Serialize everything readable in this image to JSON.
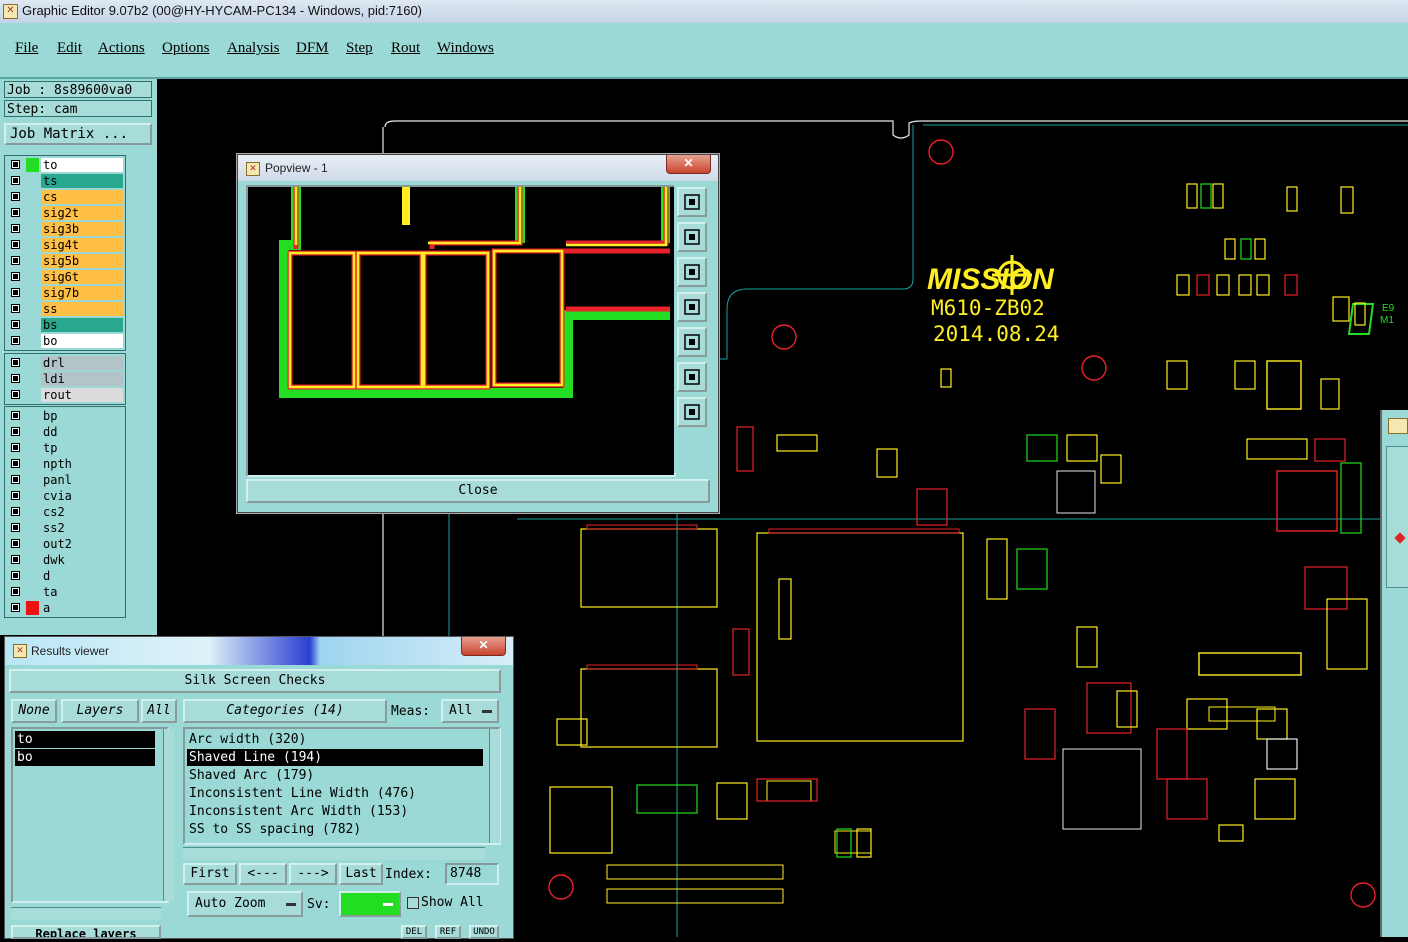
{
  "window": {
    "title": "Graphic Editor 9.07b2 (00@HY-HYCAM-PC134 - Windows, pid:7160)"
  },
  "menu": {
    "items": [
      "File",
      "Edit",
      "Actions",
      "Options",
      "Analysis",
      "DFM",
      "Step",
      "Rout",
      "Windows"
    ]
  },
  "job": {
    "job_label": "Job : 8s89600va0",
    "step_label": "Step: cam",
    "matrix_button": "Job Matrix ..."
  },
  "layers": {
    "group1": [
      {
        "name": "to",
        "color": "#ffffff",
        "swatch": "#22dd22"
      },
      {
        "name": "ts",
        "color": "#2aa88f",
        "swatch": "#9bd9d6"
      },
      {
        "name": "cs",
        "color": "#ffbf45",
        "swatch": "#9bd9d6"
      },
      {
        "name": "sig2t",
        "color": "#ffbf45",
        "swatch": "#9bd9d6"
      },
      {
        "name": "sig3b",
        "color": "#ffbf45",
        "swatch": "#9bd9d6"
      },
      {
        "name": "sig4t",
        "color": "#ffbf45",
        "swatch": "#9bd9d6"
      },
      {
        "name": "sig5b",
        "color": "#ffbf45",
        "swatch": "#9bd9d6"
      },
      {
        "name": "sig6t",
        "color": "#ffbf45",
        "swatch": "#9bd9d6"
      },
      {
        "name": "sig7b",
        "color": "#ffbf45",
        "swatch": "#9bd9d6"
      },
      {
        "name": "ss",
        "color": "#ffbf45",
        "swatch": "#9bd9d6"
      },
      {
        "name": "bs",
        "color": "#2aa88f",
        "swatch": "#9bd9d6"
      },
      {
        "name": "bo",
        "color": "#ffffff",
        "swatch": "#9bd9d6"
      }
    ],
    "group2": [
      {
        "name": "drl",
        "color": "#b3c4c9",
        "swatch": "#9bd9d6"
      },
      {
        "name": "ldi",
        "color": "#b3c4c9",
        "swatch": "#9bd9d6"
      },
      {
        "name": "rout",
        "color": "#dcdcdc",
        "swatch": "#9bd9d6"
      }
    ],
    "group3": [
      {
        "name": "bp",
        "color": "#9bd9d6",
        "swatch": "#9bd9d6"
      },
      {
        "name": "dd",
        "color": "#9bd9d6",
        "swatch": "#9bd9d6"
      },
      {
        "name": "tp",
        "color": "#9bd9d6",
        "swatch": "#9bd9d6"
      },
      {
        "name": "npth",
        "color": "#9bd9d6",
        "swatch": "#9bd9d6"
      },
      {
        "name": "panl",
        "color": "#9bd9d6",
        "swatch": "#9bd9d6"
      },
      {
        "name": "cvia",
        "color": "#9bd9d6",
        "swatch": "#9bd9d6"
      },
      {
        "name": "cs2",
        "color": "#9bd9d6",
        "swatch": "#9bd9d6"
      },
      {
        "name": "ss2",
        "color": "#9bd9d6",
        "swatch": "#9bd9d6"
      },
      {
        "name": "out2",
        "color": "#9bd9d6",
        "swatch": "#9bd9d6"
      },
      {
        "name": "dwk",
        "color": "#9bd9d6",
        "swatch": "#9bd9d6"
      },
      {
        "name": "d",
        "color": "#9bd9d6",
        "swatch": "#9bd9d6"
      },
      {
        "name": "ta",
        "color": "#9bd9d6",
        "swatch": "#9bd9d6"
      },
      {
        "name": "a",
        "color": "#9bd9d6",
        "swatch": "#ee1111"
      }
    ]
  },
  "board": {
    "logo": "MISSION",
    "model": "M610-ZB02",
    "date": "2014.08.24"
  },
  "popview": {
    "title": "Popview - 1",
    "close_label": "Close",
    "close_x": "✕"
  },
  "results": {
    "title": "Results viewer",
    "header": "Silk Screen Checks",
    "none_label": "None",
    "layers_label": "Layers",
    "all_label": "All",
    "layer_list": [
      "to",
      "bo"
    ],
    "categories_label": "Categories (14)",
    "meas_label": "Meas:",
    "meas_value": "All",
    "categories": [
      "Arc width (320)",
      "Shaved Line (194)",
      "Shaved Arc (179)",
      "Inconsistent Line Width (476)",
      "Inconsistent Arc Width (153)",
      "SS to SS spacing (782)"
    ],
    "selected_category": 1,
    "first_label": "First",
    "prev_label": "<---",
    "next_label": "--->",
    "last_label": "Last",
    "index_label": "Index:",
    "index_value": "8748",
    "autozoom_label": "Auto Zoom",
    "sv_label": "Sv:",
    "sv_color": "#22dd22",
    "show_all_label": "Show All",
    "del_label": "DEL",
    "ref_label": "REF",
    "undo_label": "UNDO",
    "replace_layers_label": "Replace layers"
  }
}
